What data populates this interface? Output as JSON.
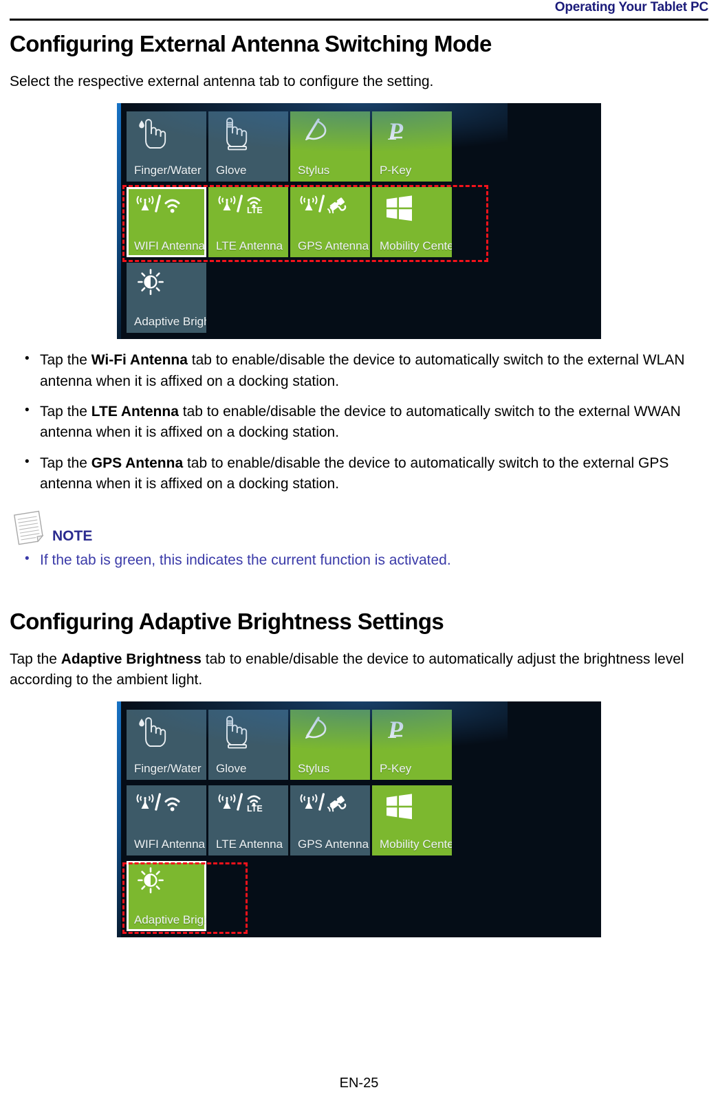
{
  "header": {
    "running_title": "Operating Your Tablet PC"
  },
  "footer": {
    "page_number": "EN-25"
  },
  "sections": {
    "antenna": {
      "heading": "Configuring External Antenna Switching Mode",
      "intro": "Select the respective external antenna tab to configure the setting.",
      "bullets": [
        {
          "lead": "Tap the ",
          "bold": "Wi-Fi Antenna",
          "rest": " tab to enable/disable the device to automatically switch to the external WLAN antenna when it is affixed on a docking station."
        },
        {
          "lead": "Tap the ",
          "bold": "LTE Antenna",
          "rest": " tab to enable/disable the device to automatically switch to the external WWAN antenna when it is affixed on a docking station."
        },
        {
          "lead": "Tap the ",
          "bold": "GPS Antenna",
          "rest": " tab to enable/disable the device to automatically switch to the external GPS antenna when it is affixed on a docking station."
        }
      ]
    },
    "note": {
      "label": "NOTE",
      "items": [
        "If the tab is green, this indicates the current function is activated."
      ]
    },
    "brightness": {
      "heading": "Configuring Adaptive Brightness Settings",
      "intro_lead": "Tap the ",
      "intro_bold": "Adaptive Brightness",
      "intro_rest": " tab to enable/disable the device to automatically adjust the brightness level according to the ambient light."
    }
  },
  "colors": {
    "active_green": "#7cb82f",
    "inactive_slate": "#3d5a68",
    "panel_background": "#050d17",
    "annotation_red": "#f4121b",
    "header_blue": "#1b1b7a",
    "note_blue": "#3a3aa8"
  },
  "screenshot_antenna": {
    "caption_context": "External antenna switching dashboard with WIFI, LTE and GPS antenna tabs highlighted",
    "tiles": [
      {
        "label": "Finger/Water",
        "icon": "finger-water-icon",
        "state": "inactive",
        "selected": false
      },
      {
        "label": "Glove",
        "icon": "glove-icon",
        "state": "inactive",
        "selected": false
      },
      {
        "label": "Stylus",
        "icon": "stylus-icon",
        "state": "active",
        "selected": false
      },
      {
        "label": "P-Key",
        "icon": "p-key-icon",
        "state": "active",
        "selected": false
      },
      {
        "label": "WIFI Antenna",
        "icon": "wifi-antenna-icon",
        "state": "active",
        "selected": true
      },
      {
        "label": "LTE Antenna",
        "icon": "lte-antenna-icon",
        "state": "active",
        "selected": false
      },
      {
        "label": "GPS Antenna",
        "icon": "gps-antenna-icon",
        "state": "active",
        "selected": false
      },
      {
        "label": "Mobility Center",
        "icon": "windows-logo-icon",
        "state": "active",
        "selected": false
      },
      {
        "label": "Adaptive Brightness",
        "icon": "brightness-icon",
        "state": "inactive",
        "selected": false
      }
    ]
  },
  "screenshot_brightness": {
    "caption_context": "Dashboard with the Adaptive Brightness tab highlighted and activated",
    "tiles": [
      {
        "label": "Finger/Water",
        "icon": "finger-water-icon",
        "state": "inactive",
        "selected": false
      },
      {
        "label": "Glove",
        "icon": "glove-icon",
        "state": "inactive",
        "selected": false
      },
      {
        "label": "Stylus",
        "icon": "stylus-icon",
        "state": "active",
        "selected": false
      },
      {
        "label": "P-Key",
        "icon": "p-key-icon",
        "state": "active",
        "selected": false
      },
      {
        "label": "WIFI Antenna",
        "icon": "wifi-antenna-icon",
        "state": "inactive",
        "selected": false
      },
      {
        "label": "LTE Antenna",
        "icon": "lte-antenna-icon",
        "state": "inactive",
        "selected": false
      },
      {
        "label": "GPS Antenna",
        "icon": "gps-antenna-icon",
        "state": "inactive",
        "selected": false
      },
      {
        "label": "Mobility Center",
        "icon": "windows-logo-icon",
        "state": "active",
        "selected": false
      },
      {
        "label": "Adaptive Brightness",
        "icon": "brightness-icon",
        "state": "active",
        "selected": true
      }
    ]
  }
}
